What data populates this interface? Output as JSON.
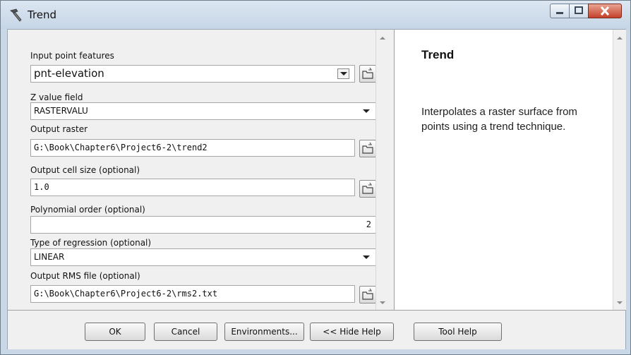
{
  "window": {
    "title": "Trend",
    "controls": [
      "minimize-icon",
      "maximize-icon",
      "close-icon"
    ]
  },
  "form": {
    "input_point_features": {
      "label": "Input point features",
      "value": "pnt-elevation"
    },
    "z_value_field": {
      "label": "Z value field",
      "value": "RASTERVALU"
    },
    "output_raster": {
      "label": "Output raster",
      "value": "G:\\Book\\Chapter6\\Project6-2\\trend2"
    },
    "output_cell_size": {
      "label": "Output cell size (optional)",
      "value": "1.0"
    },
    "polynomial_order": {
      "label": "Polynomial order (optional)",
      "value": "2"
    },
    "type_of_regression": {
      "label": "Type of regression (optional)",
      "value": "LINEAR"
    },
    "output_rms_file": {
      "label": "Output RMS file (optional)",
      "value": "G:\\Book\\Chapter6\\Project6-2\\rms2.txt"
    }
  },
  "help": {
    "title": "Trend",
    "body": "Interpolates a raster surface from points using a trend technique."
  },
  "buttons": {
    "ok": "OK",
    "cancel": "Cancel",
    "environments": "Environments...",
    "hide_help": "<< Hide Help",
    "tool_help": "Tool Help"
  },
  "colors": {
    "title_bar": "#c6d5e5",
    "close_button": "#c4412a",
    "panel_bg": "#f0f0f0"
  }
}
